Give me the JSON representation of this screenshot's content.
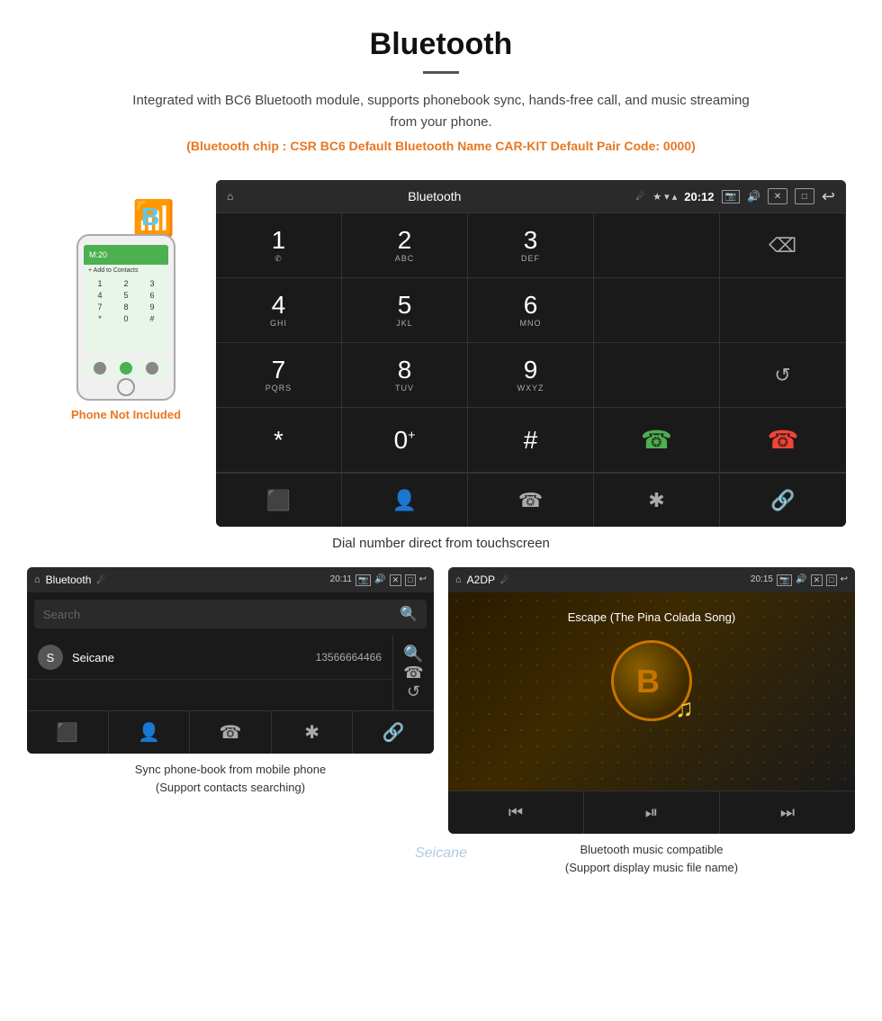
{
  "header": {
    "title": "Bluetooth",
    "description": "Integrated with BC6 Bluetooth module, supports phonebook sync, hands-free call, and music streaming from your phone.",
    "specs": "(Bluetooth chip : CSR BC6    Default Bluetooth Name CAR-KIT    Default Pair Code: 0000)"
  },
  "phone_side": {
    "not_included_label": "Phone Not Included"
  },
  "dial_screen": {
    "statusbar_title": "Bluetooth",
    "time": "20:12",
    "keys": [
      {
        "main": "1",
        "sub": "⌂"
      },
      {
        "main": "2",
        "sub": "ABC"
      },
      {
        "main": "3",
        "sub": "DEF"
      },
      {
        "main": "",
        "sub": ""
      },
      {
        "main": "⌫",
        "sub": ""
      },
      {
        "main": "4",
        "sub": "GHI"
      },
      {
        "main": "5",
        "sub": "JKL"
      },
      {
        "main": "6",
        "sub": "MNO"
      },
      {
        "main": "",
        "sub": ""
      },
      {
        "main": "",
        "sub": ""
      },
      {
        "main": "7",
        "sub": "PQRS"
      },
      {
        "main": "8",
        "sub": "TUV"
      },
      {
        "main": "9",
        "sub": "WXYZ"
      },
      {
        "main": "",
        "sub": ""
      },
      {
        "main": "↻",
        "sub": ""
      },
      {
        "main": "*",
        "sub": ""
      },
      {
        "main": "0",
        "sub": "+"
      },
      {
        "main": "#",
        "sub": ""
      },
      {
        "main": "✆",
        "sub": "green"
      },
      {
        "main": "✆",
        "sub": "red"
      }
    ],
    "nav": [
      "⊞",
      "👤",
      "✆",
      "✱",
      "🔗"
    ]
  },
  "dial_caption": "Dial number direct from touchscreen",
  "phonebook_screen": {
    "statusbar_title": "Bluetooth",
    "time": "20:11",
    "search_placeholder": "Search",
    "contacts": [
      {
        "initial": "S",
        "name": "Seicane",
        "number": "13566664466"
      }
    ],
    "nav_items": [
      "⊞",
      "👤",
      "✆",
      "✱",
      "🔗"
    ]
  },
  "phonebook_caption_line1": "Sync phone-book from mobile phone",
  "phonebook_caption_line2": "(Support contacts searching)",
  "music_screen": {
    "statusbar_title": "A2DP",
    "time": "20:15",
    "song_title": "Escape (The Pina Colada Song)",
    "nav_items": [
      "⏮",
      "⏯",
      "⏭"
    ]
  },
  "music_caption_line1": "Bluetooth music compatible",
  "music_caption_line2": "(Support display music file name)",
  "watermark": "Seicane"
}
